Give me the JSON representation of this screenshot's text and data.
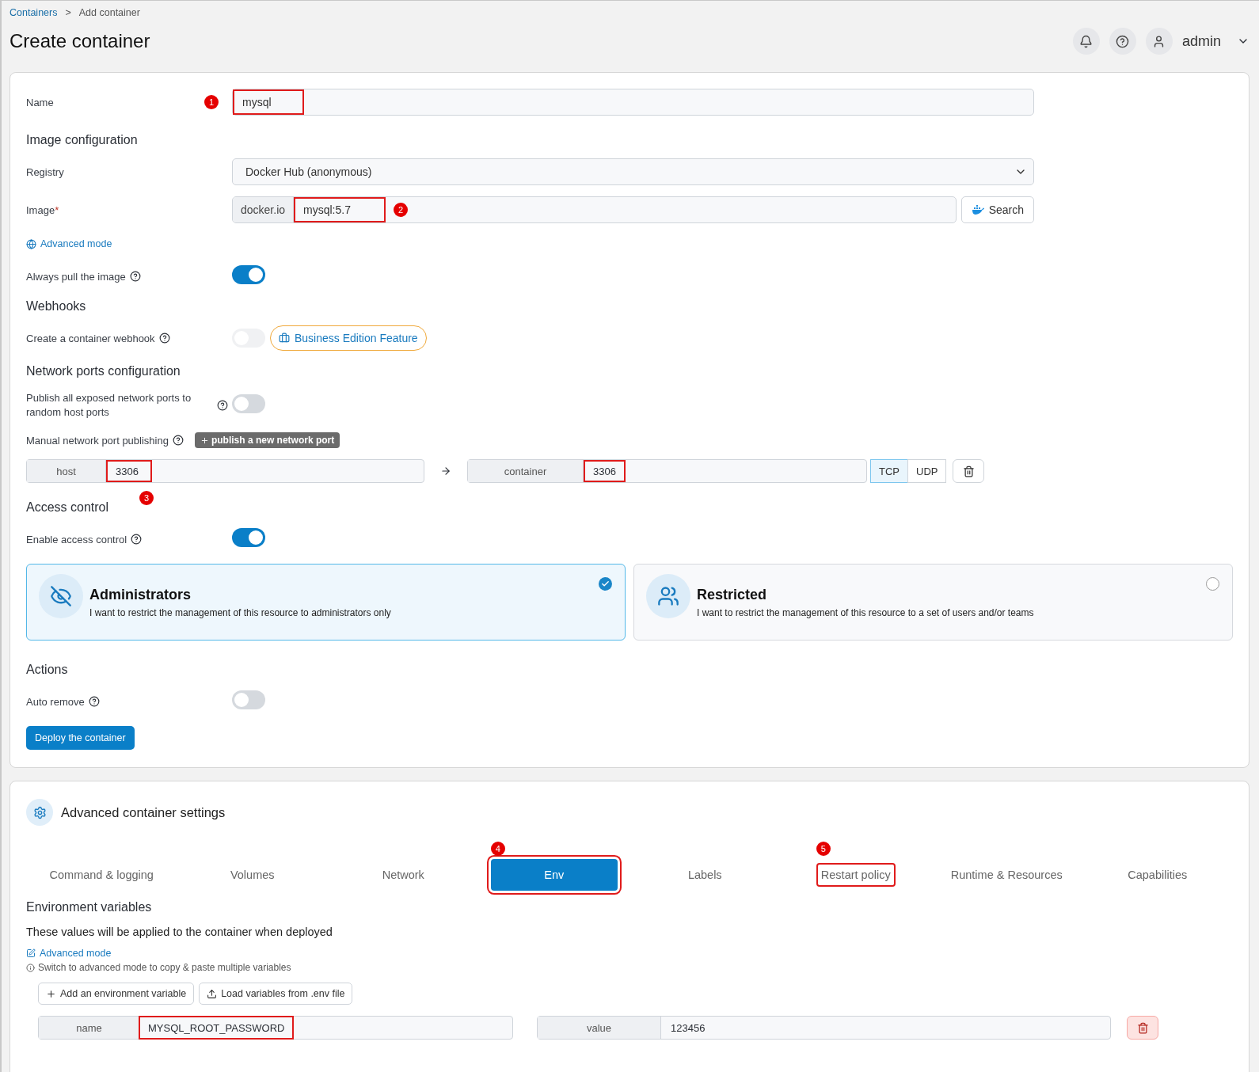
{
  "breadcrumb": {
    "parent": "Containers",
    "separator": ">",
    "current": "Add container"
  },
  "title": "Create container",
  "header": {
    "user": "admin"
  },
  "form": {
    "name": {
      "label": "Name",
      "value": "mysql",
      "highlighted": true,
      "marker": "1"
    },
    "image_configuration": {
      "heading": "Image configuration",
      "registry": {
        "label": "Registry",
        "value": "Docker Hub (anonymous)"
      },
      "image": {
        "label": "Image",
        "required_mark": "*",
        "prefix": "docker.io",
        "value": "mysql:5.7",
        "highlighted": true,
        "marker": "2",
        "search_button": "Search"
      },
      "advanced_mode": "Advanced mode",
      "always_pull": {
        "label": "Always pull the image",
        "on": true
      }
    },
    "webhooks": {
      "heading": "Webhooks",
      "create_webhook": {
        "label": "Create a container webhook",
        "on": false,
        "disabled": true
      },
      "badge": "Business Edition Feature"
    },
    "network_ports": {
      "heading": "Network ports configuration",
      "publish_all": {
        "label": "Publish all exposed network ports to random host ports",
        "on": false
      },
      "manual": {
        "label": "Manual network port publishing",
        "button": "publish a new network port"
      },
      "ports": [
        {
          "host_label": "host",
          "host": "3306",
          "container_label": "container",
          "container": "3306",
          "highlighted": true,
          "marker": "3",
          "protocols": [
            {
              "label": "TCP",
              "selected": true
            },
            {
              "label": "UDP",
              "selected": false
            }
          ]
        }
      ]
    },
    "access_control": {
      "heading": "Access control",
      "enable": {
        "label": "Enable access control",
        "on": true
      },
      "options": [
        {
          "kind": "administrators",
          "title": "Administrators",
          "description": "I want to restrict the management of this resource to administrators only",
          "selected": true
        },
        {
          "kind": "restricted",
          "title": "Restricted",
          "description": "I want to restrict the management of this resource to a set of users and/or teams",
          "selected": false
        }
      ]
    },
    "actions": {
      "heading": "Actions",
      "auto_remove": {
        "label": "Auto remove",
        "on": false
      },
      "deploy_button": "Deploy the container"
    }
  },
  "advanced": {
    "title": "Advanced container settings",
    "tabs": [
      {
        "label": "Command & logging",
        "selected": false,
        "highlighted": false
      },
      {
        "label": "Volumes",
        "selected": false,
        "highlighted": false
      },
      {
        "label": "Network",
        "selected": false,
        "highlighted": false
      },
      {
        "label": "Env",
        "selected": true,
        "highlighted": true,
        "marker": "4"
      },
      {
        "label": "Labels",
        "selected": false,
        "highlighted": false
      },
      {
        "label": "Restart policy",
        "selected": false,
        "highlighted": true,
        "marker": "5"
      },
      {
        "label": "Runtime & Resources",
        "selected": false,
        "highlighted": false
      },
      {
        "label": "Capabilities",
        "selected": false,
        "highlighted": false
      }
    ],
    "env": {
      "heading": "Environment variables",
      "description": "These values will be applied to the container when deployed",
      "advanced_mode": "Advanced mode",
      "hint": "Switch to advanced mode to copy & paste multiple variables",
      "add_button": "Add an environment variable",
      "load_button": "Load variables from .env file",
      "variables": [
        {
          "name_label": "name",
          "name": "MYSQL_ROOT_PASSWORD",
          "value_label": "value",
          "value": "123456",
          "highlighted": true
        }
      ]
    }
  }
}
